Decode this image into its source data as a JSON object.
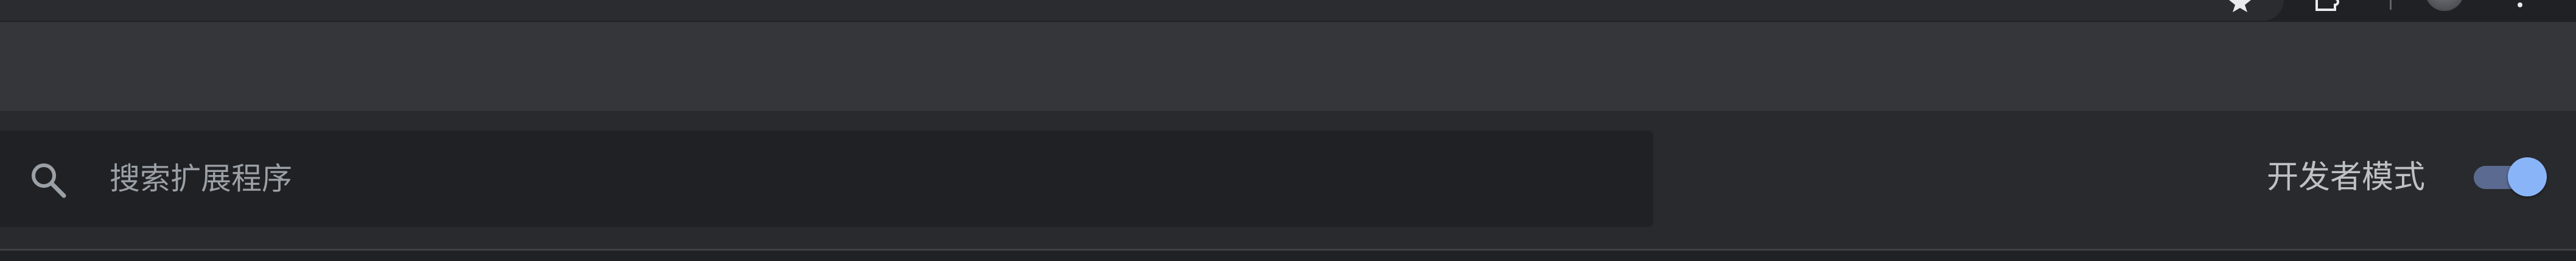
{
  "search": {
    "placeholder": "搜索扩展程序",
    "value": ""
  },
  "dev_mode": {
    "label": "开发者模式",
    "enabled": true
  },
  "browser_toolbar": {
    "icons": [
      "star-icon",
      "extensions-puzzle-icon",
      "profile-avatar",
      "kebab-menu-icon"
    ]
  },
  "colors": {
    "toolbar_bg": "#292a2d",
    "header_band_bg": "#35363a",
    "search_bg": "#202124",
    "toggle_track": "#5a6a91",
    "toggle_knob": "#8ab4f8",
    "label_text": "#bdc1c6",
    "placeholder_text": "#9aa0a6"
  }
}
